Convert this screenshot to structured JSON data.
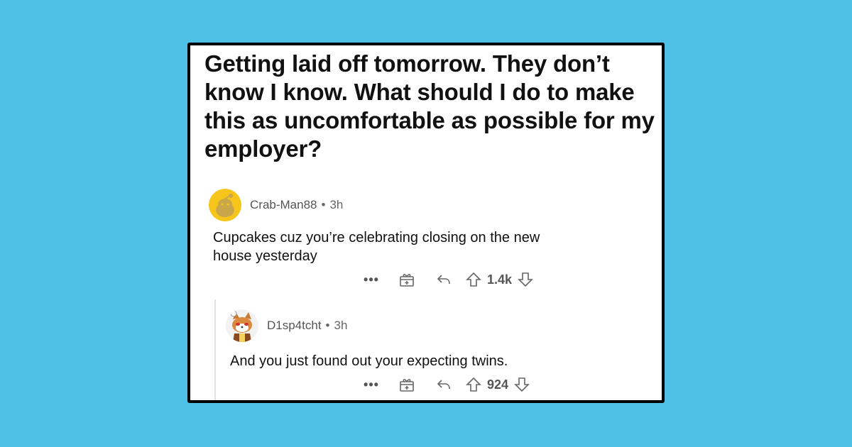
{
  "post": {
    "title": "Getting laid off tomorrow. They don’t know I know. What should I do to make this as uncomfortable as possible for my employer?"
  },
  "comments": [
    {
      "username": "Crab-Man88",
      "separator": "•",
      "time": "3h",
      "body": "Cupcakes cuz you’re celebrating closing on the new house yesterday",
      "more": "•••",
      "votes": "1.4k",
      "avatar_icon": "snoo-avatar-icon",
      "avatar_color": "#f5c51a"
    },
    {
      "username": "D1sp4tcht",
      "separator": "•",
      "time": "3h",
      "body": "And you just found out your expecting twins.",
      "more": "•••",
      "votes": "924",
      "avatar_icon": "cat-snoo-avatar-icon",
      "avatar_color": "#d98a3c"
    }
  ],
  "colors": {
    "background": "#4fc0e5",
    "card_border": "#000000",
    "text": "#111111",
    "meta": "#666666"
  }
}
